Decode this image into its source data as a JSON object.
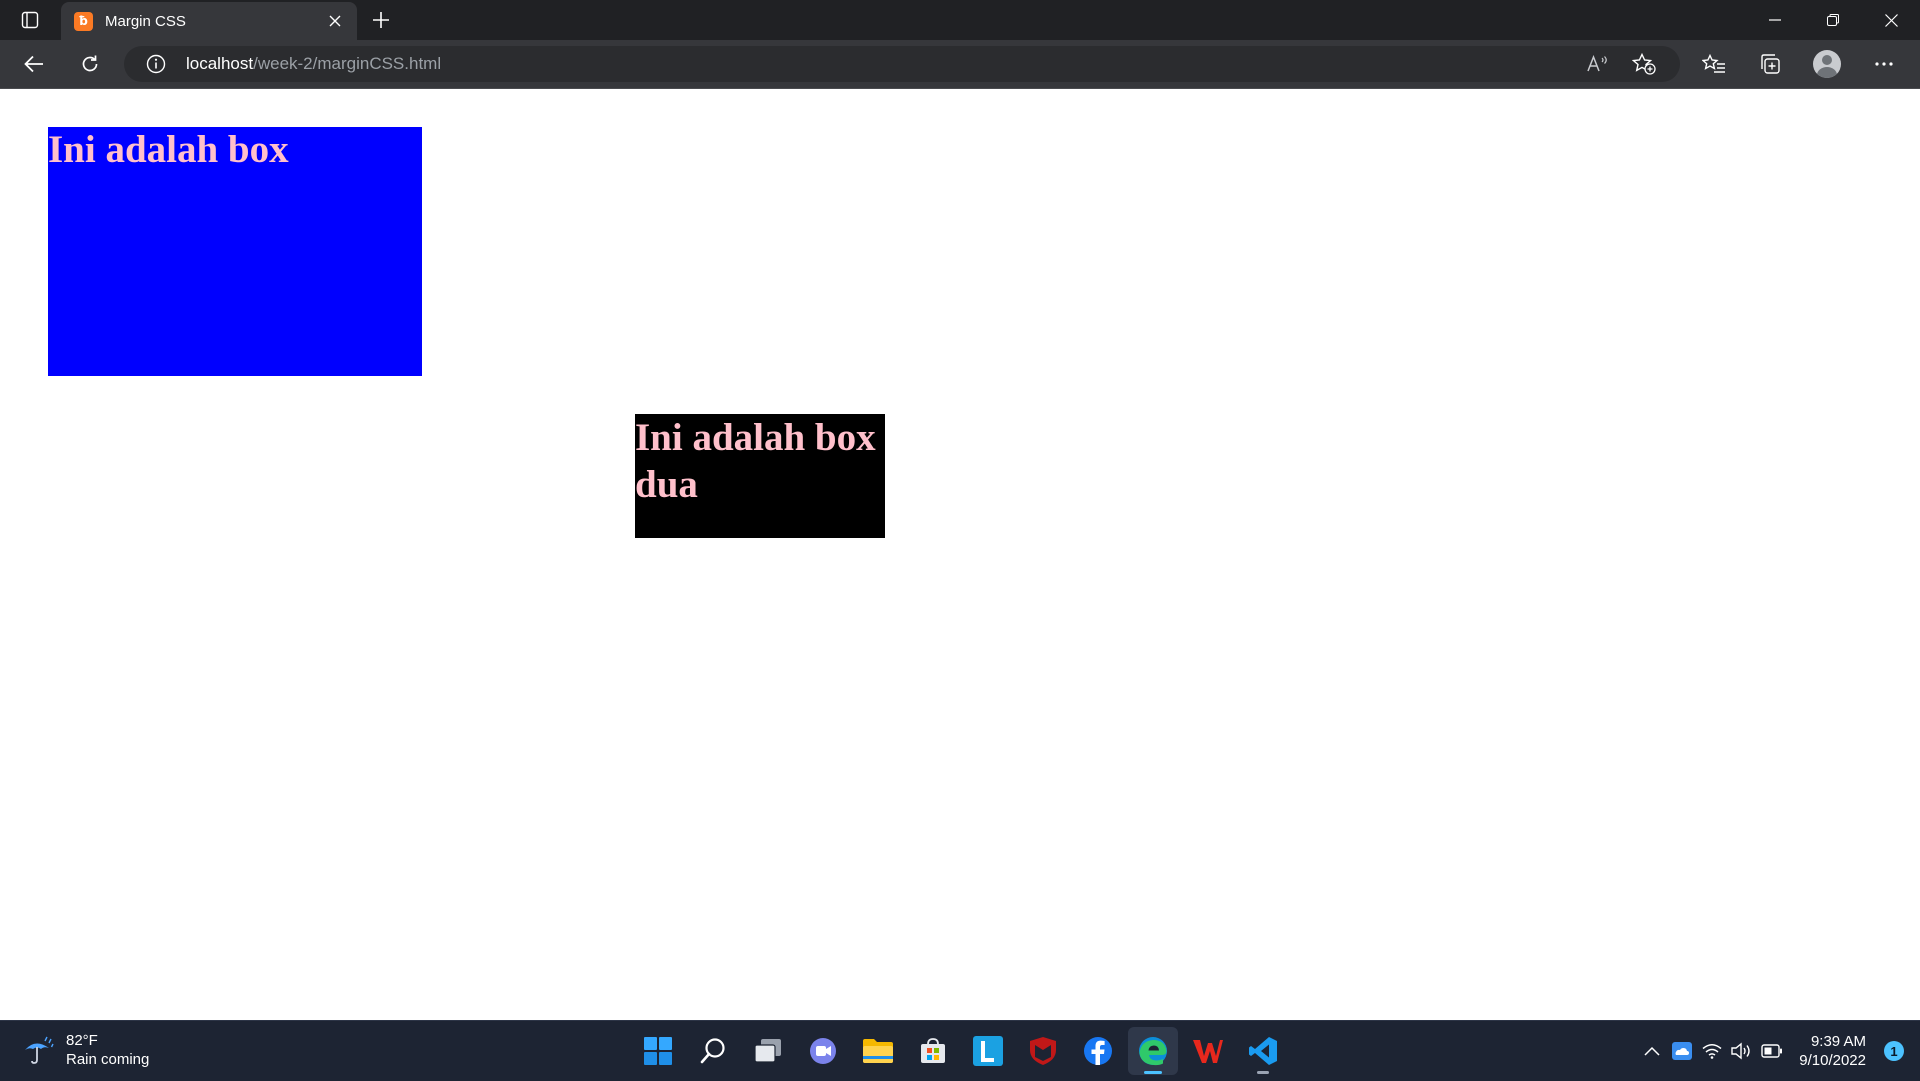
{
  "browser": {
    "tab": {
      "title": "Margin CSS",
      "favicon": "xampp-favicon"
    },
    "address": {
      "host": "localhost",
      "path": "/week-2/marginCSS.html"
    },
    "toolbar_icons": [
      "back-icon",
      "refresh-icon",
      "info-icon",
      "read-aloud-icon",
      "add-favorite-icon",
      "favorites-icon",
      "collections-icon",
      "profile-avatar",
      "more-icon"
    ]
  },
  "page": {
    "box_satu": {
      "text": "Ini adalah box",
      "background": "#0000ff",
      "color": "#ffc0cb"
    },
    "box_dua": {
      "text": "Ini adalah box dua",
      "background": "#000000",
      "color": "#ffc0cb"
    }
  },
  "taskbar": {
    "weather": {
      "temp": "82°F",
      "condition": "Rain coming"
    },
    "apps": [
      "start",
      "search",
      "task-view",
      "teams-chat",
      "file-explorer",
      "microsoft-store",
      "l-app",
      "mcafee",
      "facebook",
      "edge",
      "wps-office",
      "vscode"
    ],
    "clock": {
      "time": "9:39 AM",
      "date": "9/10/2022"
    },
    "notification_count": "1"
  }
}
